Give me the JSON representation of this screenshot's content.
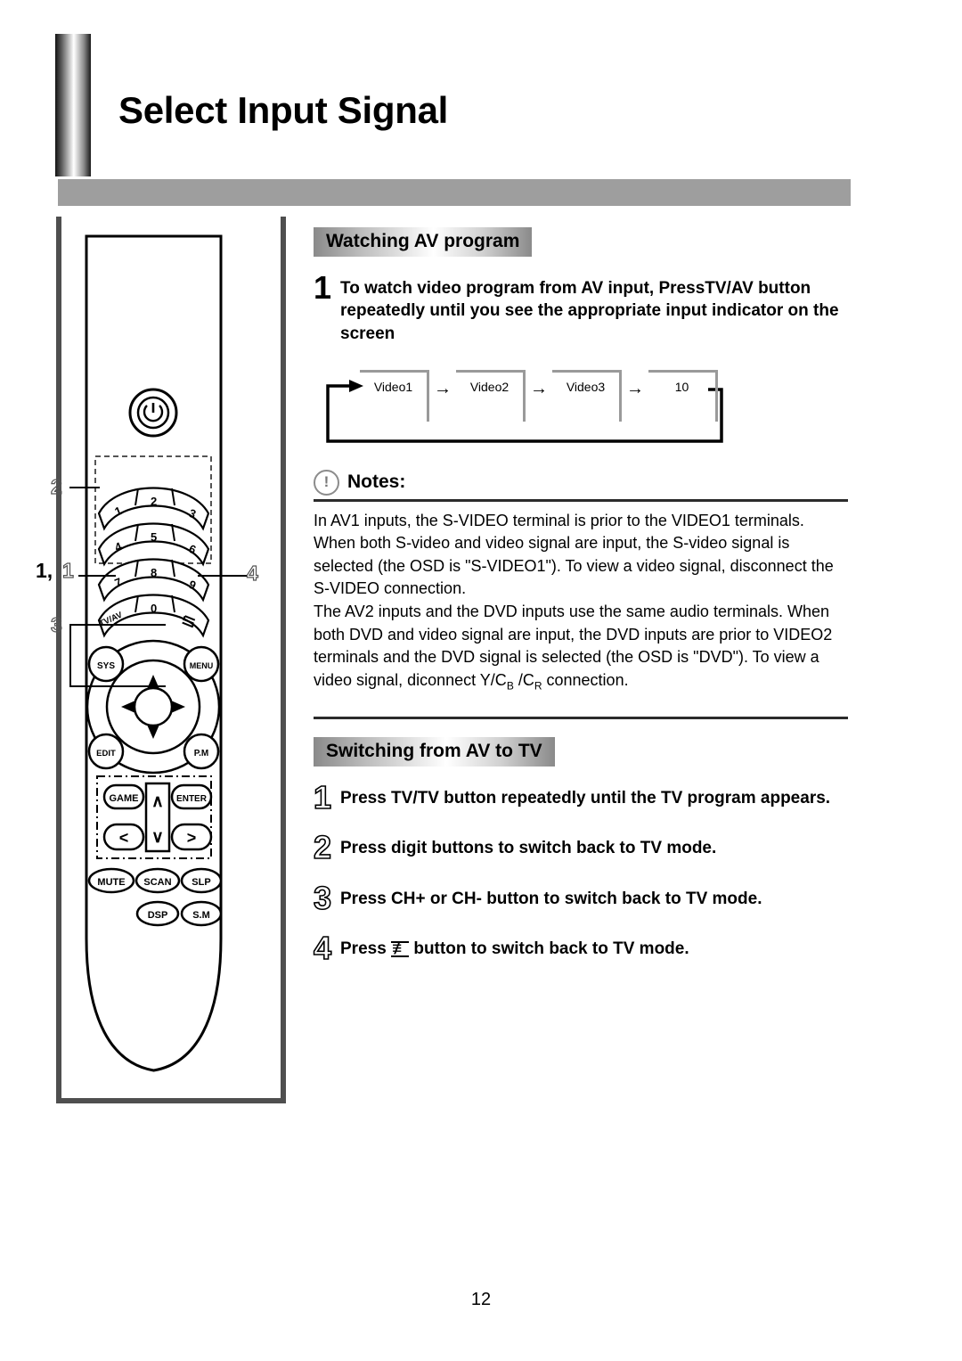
{
  "document": {
    "title": "Select Input Signal",
    "page_number": "12"
  },
  "sections": [
    {
      "heading": "Watching AV program",
      "steps": [
        {
          "number": "1",
          "style": "solid",
          "text": "To watch video program from AV input, PressTV/AV button repeatedly until you see the appropriate input indicator on the screen"
        }
      ]
    },
    {
      "heading": "Switching from AV to TV",
      "steps": [
        {
          "number": "1",
          "style": "hollow",
          "text": "Press TV/TV button repeatedly until the TV program appears."
        },
        {
          "number": "2",
          "style": "hollow",
          "text": "Press digit buttons to switch back to TV mode."
        },
        {
          "number": "3",
          "style": "hollow",
          "text": "Press CH+ or CH- button to switch back to TV mode."
        },
        {
          "number": "4",
          "style": "hollow",
          "text": "Press",
          "text_after": "button to switch back to TV mode.",
          "glyph": "return-icon"
        }
      ]
    }
  ],
  "flow_diagram": {
    "nodes": [
      "Video1",
      "Video2",
      "Video3",
      "10"
    ],
    "arrow": "→",
    "loops_back": true
  },
  "notes": {
    "icon": "exclamation-circle-icon",
    "label": "Notes:",
    "paragraphs": [
      "In AV1 inputs, the S-VIDEO terminal is prior to the VIDEO1 terminals. When both S-video and video signal are input, the S-video signal is selected (the OSD is \"S-VIDEO1\"). To view a video signal, disconnect the S-VIDEO connection.",
      "The AV2 inputs and the DVD inputs use the same audio terminals. When both DVD and video signal are input, the DVD inputs are prior to VIDEO2 terminals and the DVD signal is selected (the OSD is \"DVD\"). To view a video signal, diconnect Y/C",
      "B",
      " /C",
      "R",
      " connection."
    ]
  },
  "remote": {
    "power_button": "power-icon",
    "keypad": [
      [
        "1",
        "2",
        "3"
      ],
      [
        "4",
        "5",
        "6"
      ],
      [
        "7",
        "8",
        "9"
      ]
    ],
    "bottom_row": [
      "TV/AV",
      "0",
      "return-icon"
    ],
    "round_buttons": [
      "SYS",
      "MENU",
      "EDIT",
      "P.M"
    ],
    "dpad": [
      "up-arrow",
      "left-arrow",
      "right-arrow",
      "down-arrow",
      "center"
    ],
    "game_block": [
      "GAME",
      "∧",
      "ENTER",
      "<",
      "∨",
      ">"
    ],
    "oval_buttons_row1": [
      "MUTE",
      "SCAN",
      "SLP"
    ],
    "oval_buttons_row2": [
      "DSP",
      "S.M"
    ],
    "callouts": [
      {
        "label": "2",
        "style": "hollow"
      },
      {
        "label": "1,",
        "style": "solid"
      },
      {
        "label": "1",
        "style": "hollow"
      },
      {
        "label": "3",
        "style": "hollow"
      },
      {
        "label": "4",
        "style": "hollow"
      }
    ]
  },
  "colors": {
    "band": "#9e9e9e",
    "frame": "#4f4f4f",
    "flow_box_border": "#9a9a9a",
    "rule": "#2b2b2b"
  }
}
